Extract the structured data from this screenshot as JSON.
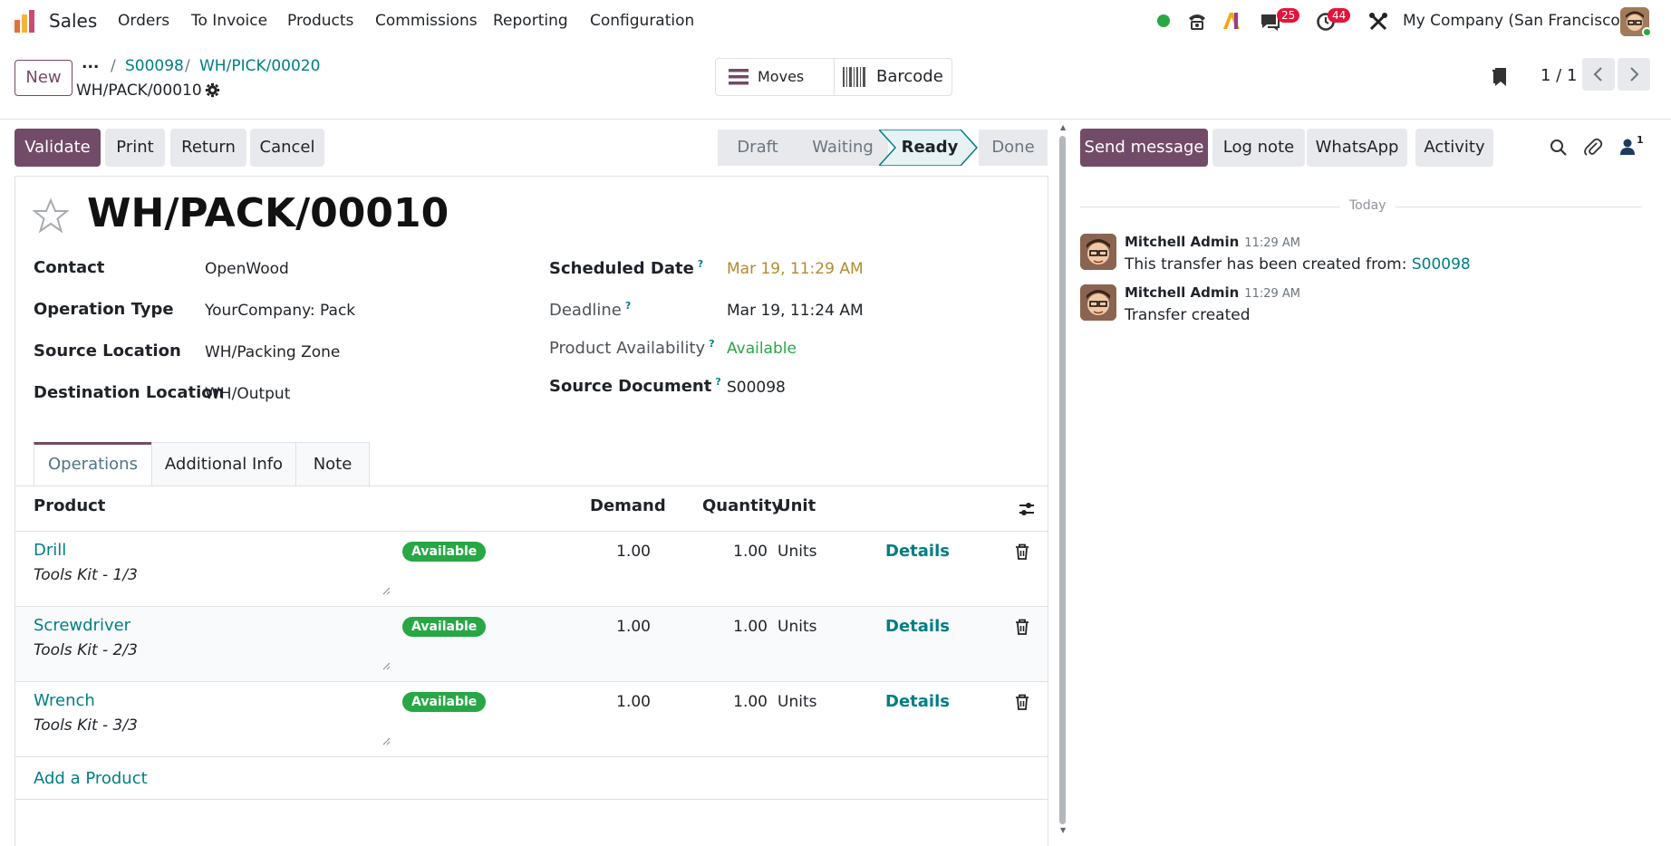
{
  "nav": {
    "app_name": "Sales",
    "menu": [
      "Orders",
      "To Invoice",
      "Products",
      "Commissions",
      "Reporting",
      "Configuration"
    ],
    "messages_count": "25",
    "activities_count": "44",
    "company": "My Company (San Francisco)"
  },
  "control": {
    "new_label": "New",
    "more": "...",
    "breadcrumb": [
      "S00098",
      "WH/PICK/00020"
    ],
    "current": "WH/PACK/00010",
    "moves_label": "Moves",
    "barcode_label": "Barcode",
    "pager": "1 / 1"
  },
  "actions": {
    "validate": "Validate",
    "print": "Print",
    "return": "Return",
    "cancel": "Cancel"
  },
  "statusbar": [
    "Draft",
    "Waiting",
    "Ready",
    "Done"
  ],
  "statusbar_active": "Ready",
  "record": {
    "title": "WH/PACK/00010",
    "contact_label": "Contact",
    "contact": "OpenWood",
    "operation_type_label": "Operation Type",
    "operation_type": "YourCompany: Pack",
    "source_location_label": "Source Location",
    "source_location": "WH/Packing Zone",
    "destination_location_label": "Destination Location",
    "destination_location": "WH/Output",
    "scheduled_date_label": "Scheduled Date",
    "scheduled_date": "Mar 19, 11:29 AM",
    "deadline_label": "Deadline",
    "deadline": "Mar 19, 11:24 AM",
    "availability_label": "Product Availability",
    "availability": "Available",
    "source_document_label": "Source Document",
    "source_document": "S00098",
    "help_mark": "?"
  },
  "tabs": [
    "Operations",
    "Additional Info",
    "Note"
  ],
  "table": {
    "headers": {
      "product": "Product",
      "demand": "Demand",
      "quantity": "Quantity",
      "unit": "Unit"
    },
    "rows": [
      {
        "product": "Drill",
        "description": "Tools Kit - 1/3",
        "status": "Available",
        "demand": "1.00",
        "quantity": "1.00",
        "unit": "Units",
        "details": "Details"
      },
      {
        "product": "Screwdriver",
        "description": "Tools Kit - 2/3",
        "status": "Available",
        "demand": "1.00",
        "quantity": "1.00",
        "unit": "Units",
        "details": "Details"
      },
      {
        "product": "Wrench",
        "description": "Tools Kit - 3/3",
        "status": "Available",
        "demand": "1.00",
        "quantity": "1.00",
        "unit": "Units",
        "details": "Details"
      }
    ],
    "add_product": "Add a Product"
  },
  "chatter": {
    "send_message": "Send message",
    "log_note": "Log note",
    "whatsapp": "WhatsApp",
    "activity": "Activity",
    "followers_count": "1",
    "date_separator": "Today",
    "messages": [
      {
        "author": "Mitchell Admin",
        "time": "11:29 AM",
        "body": "This transfer has been created from: ",
        "link": "S00098"
      },
      {
        "author": "Mitchell Admin",
        "time": "11:29 AM",
        "body": "Transfer created",
        "link": ""
      }
    ]
  },
  "colors": {
    "primary": "#714b67",
    "link": "#017e84",
    "success": "#28a745",
    "danger": "#e3143b",
    "date_warning": "#b38a30"
  }
}
